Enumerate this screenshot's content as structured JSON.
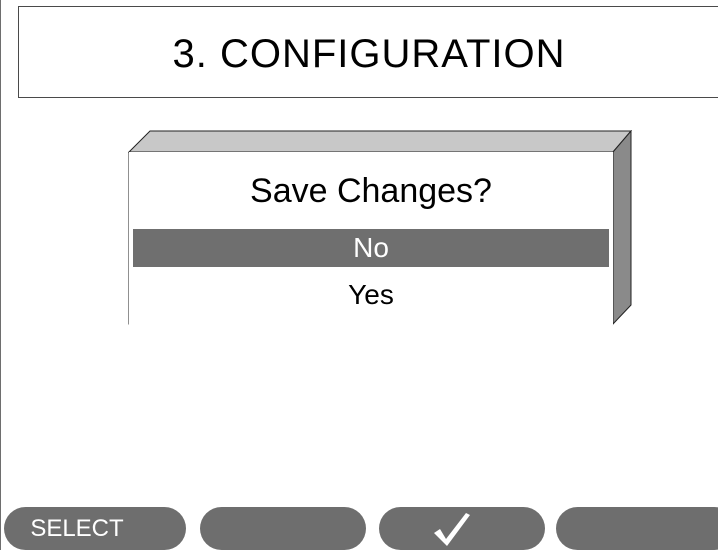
{
  "header": {
    "title": "3. CONFIGURATION"
  },
  "dialog": {
    "title": "Save Changes?",
    "options": [
      {
        "label": "No",
        "selected": true
      },
      {
        "label": "Yes",
        "selected": false
      }
    ]
  },
  "softkeys": {
    "key1_label": "SELECT",
    "key2_label": "",
    "key3_icon": "checkmark-icon",
    "key4_label": ""
  },
  "colors": {
    "selection_bg": "#6f6f6f",
    "softkey_bg": "#6e6e6e",
    "dialog_side": "#8a8a8a",
    "dialog_top": "#c8c8c8"
  }
}
